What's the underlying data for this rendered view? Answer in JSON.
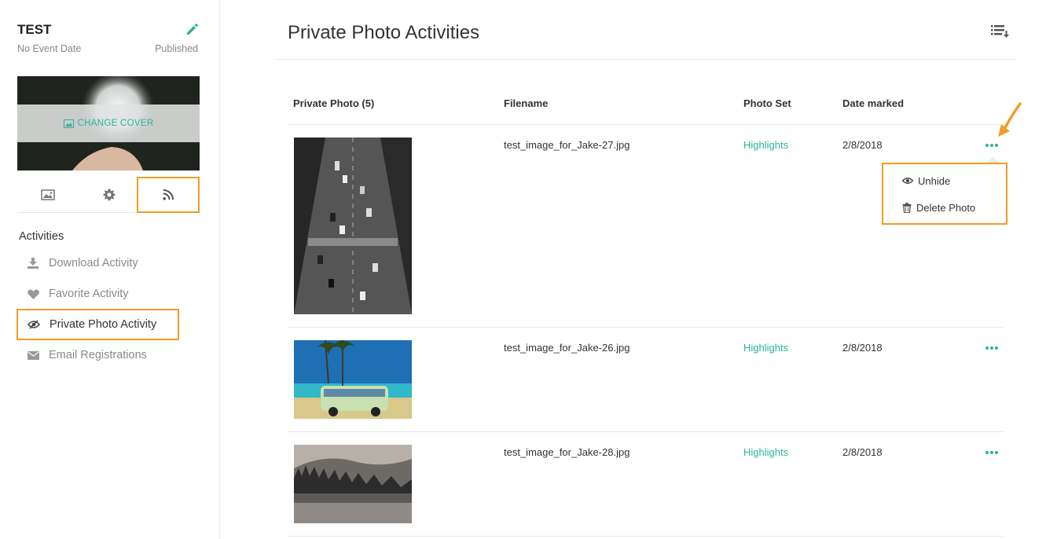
{
  "event": {
    "title": "TEST",
    "date": "No Event Date",
    "status": "Published",
    "cover_label": "CHANGE COVER"
  },
  "sidebar": {
    "tabs": [
      {
        "icon": "image-icon"
      },
      {
        "icon": "gear-icon"
      },
      {
        "icon": "rss-icon",
        "highlighted": true
      }
    ],
    "section_heading": "Activities",
    "items": [
      {
        "label": "Download Activity",
        "icon": "download-icon"
      },
      {
        "label": "Favorite Activity",
        "icon": "heart-icon"
      },
      {
        "label": "Private Photo Activity",
        "icon": "eye-slash-icon",
        "active": true
      },
      {
        "label": "Email Registrations",
        "icon": "envelope-icon"
      }
    ]
  },
  "main": {
    "title": "Private Photo Activities",
    "columns": {
      "photo": "Private Photo (5)",
      "filename": "Filename",
      "set": "Photo Set",
      "date": "Date marked"
    },
    "rows": [
      {
        "filename": "test_image_for_Jake-27.jpg",
        "set": "Highlights",
        "date": "2/8/2018"
      },
      {
        "filename": "test_image_for_Jake-26.jpg",
        "set": "Highlights",
        "date": "2/8/2018"
      },
      {
        "filename": "test_image_for_Jake-28.jpg",
        "set": "Highlights",
        "date": "2/8/2018"
      }
    ],
    "menu": {
      "unhide": "Unhide",
      "delete": "Delete Photo"
    }
  },
  "colors": {
    "accent": "#2bb39b",
    "highlight": "#f39c26"
  }
}
